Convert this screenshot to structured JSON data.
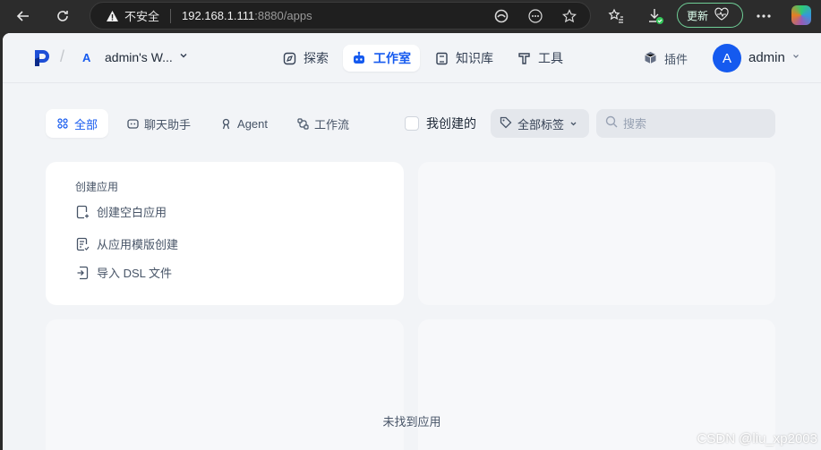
{
  "browser": {
    "insecure_label": "不安全",
    "url_host": "192.168.1.111",
    "url_rest": ":8880/apps",
    "update_label": "更新"
  },
  "header": {
    "workspace_letter": "A",
    "workspace_name": "admin's W...",
    "nav": [
      {
        "label": "探索",
        "icon": "compass-icon"
      },
      {
        "label": "工作室",
        "icon": "robot-icon"
      },
      {
        "label": "知识库",
        "icon": "book-icon"
      },
      {
        "label": "工具",
        "icon": "hammer-icon"
      }
    ],
    "plugins_label": "插件",
    "avatar_letter": "A",
    "user_name": "admin"
  },
  "filters": {
    "tabs": [
      {
        "label": "全部",
        "icon": "grid-icon"
      },
      {
        "label": "聊天助手",
        "icon": "chat-icon"
      },
      {
        "label": "Agent",
        "icon": "agent-icon"
      },
      {
        "label": "工作流",
        "icon": "workflow-icon"
      }
    ],
    "mine_label": "我创建的",
    "tags_label": "全部标签",
    "search_placeholder": "搜索"
  },
  "create_card": {
    "title": "创建应用",
    "items": [
      {
        "label": "创建空白应用",
        "icon": "file-plus-icon"
      },
      {
        "label": "从应用模版创建",
        "icon": "file-template-icon"
      },
      {
        "label": "导入 DSL 文件",
        "icon": "file-import-icon"
      }
    ]
  },
  "empty_message": "未找到应用",
  "watermark": "CSDN @liu_xp2003",
  "colors": {
    "accent": "#155aef",
    "page_bg": "#f2f4f7",
    "chrome_bg": "#2c2c2c"
  }
}
